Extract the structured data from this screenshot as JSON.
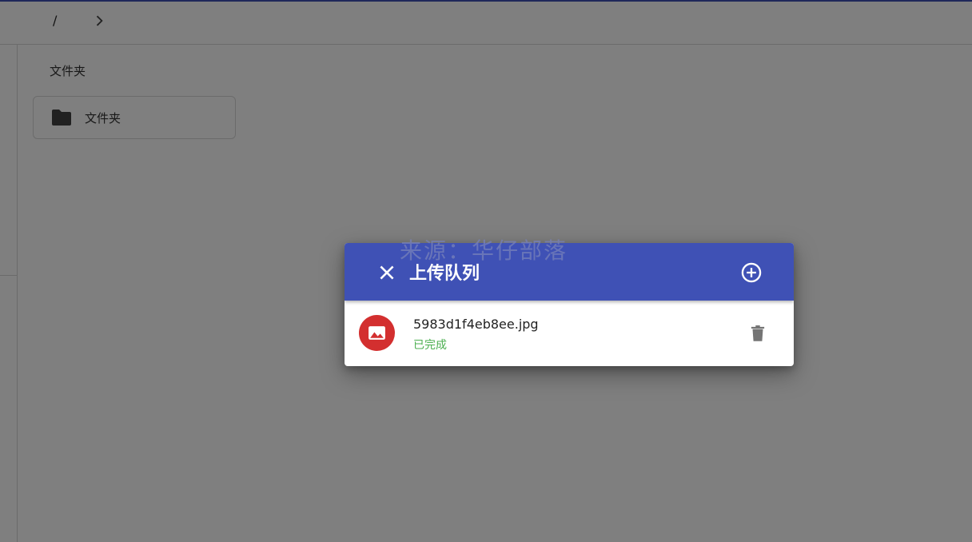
{
  "breadcrumb": {
    "root": "/"
  },
  "main": {
    "section_label": "文件夹",
    "folders": [
      {
        "name": "文件夹"
      }
    ]
  },
  "dialog": {
    "title": "上传队列",
    "items": [
      {
        "filename": "5983d1f4eb8ee.jpg",
        "status": "已完成"
      }
    ]
  },
  "watermark": {
    "text": "来源：华仔部落"
  },
  "colors": {
    "primary": "#3f51b5",
    "file_avatar": "#d32f2f",
    "status_done": "#4caf50"
  },
  "icons": {
    "close": "close-icon",
    "add": "add-circle-icon",
    "file": "image-icon",
    "delete": "trash-icon",
    "folder": "folder-icon",
    "chevron": "chevron-right-icon"
  }
}
